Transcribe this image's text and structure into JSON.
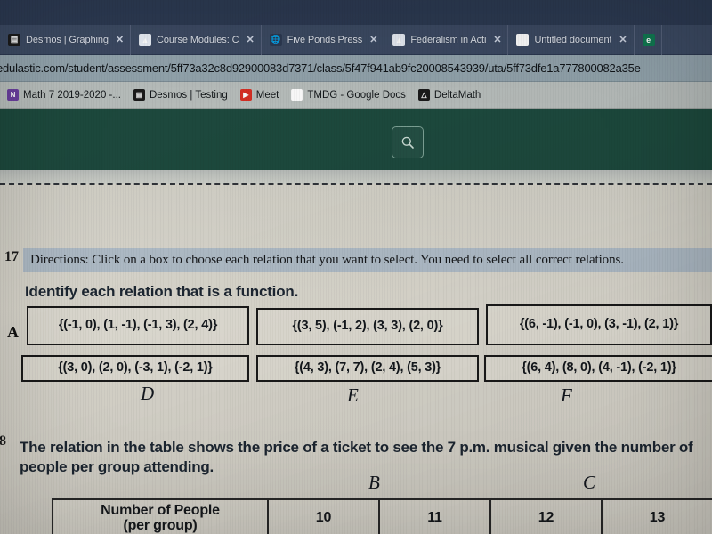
{
  "browser": {
    "tabs": [
      {
        "title": "Desmos | Graphing",
        "favicon": "desmos-icon",
        "close": "✕"
      },
      {
        "title": "Course Modules: C",
        "favicon": "canvas-icon",
        "close": "✕"
      },
      {
        "title": "Five Ponds Press",
        "favicon": "globe-icon",
        "close": "✕"
      },
      {
        "title": "Federalism in Acti",
        "favicon": "canvas-icon",
        "close": "✕"
      },
      {
        "title": "Untitled document",
        "favicon": "docs-icon",
        "close": "✕"
      }
    ],
    "url": "edulastic.com/student/assessment/5ff73a32c8d92900083d7371/class/5f47f941ab9fc20008543939/uta/5ff73dfe1a777800082a35e",
    "bookmarks": [
      {
        "label": "Math 7 2019-2020 -...",
        "icon": "onenote-icon"
      },
      {
        "label": "Desmos | Testing",
        "icon": "desmos-icon"
      },
      {
        "label": "Meet",
        "icon": "meet-icon"
      },
      {
        "label": "TMDG - Google Docs",
        "icon": "docs-icon"
      },
      {
        "label": "DeltaMath",
        "icon": "deltamath-icon"
      }
    ]
  },
  "app": {
    "header_color": "#1d4a3e",
    "search_icon": "search-icon"
  },
  "question17": {
    "number": "17",
    "directions": "Directions: Click on a box to choose each relation that you want to select. You need to select all correct relations.",
    "prompt": "Identify each relation that is a function.",
    "choices": [
      {
        "letter": "A",
        "text": "{(-1, 0), (1, -1), (-1, 3), (2, 4)}",
        "handwritten": ""
      },
      {
        "letter": "B",
        "text": "{(3, 5), (-1, 2), (3, 3), (2, 0)}",
        "handwritten": "B"
      },
      {
        "letter": "C",
        "text": "{(6, -1), (-1, 0), (3, -1), (2, 1)}",
        "handwritten": "C"
      },
      {
        "letter": "D",
        "text": "{(3, 0), (2, 0), (-3, 1), (-2, 1)}",
        "handwritten": "D"
      },
      {
        "letter": "E",
        "text": "{(4, 3), (7, 7), (2, 4), (5, 3)}",
        "handwritten": "E"
      },
      {
        "letter": "F",
        "text": "{(6, 4), (8, 0), (4, -1), (-2, 1)}",
        "handwritten": "F"
      }
    ]
  },
  "question18": {
    "number": "8",
    "text": "The relation in the table shows the price of a ticket to see the 7 p.m. musical given the number of people per group attending.",
    "table": {
      "row_header": "Number of People (per group)",
      "row_header_line1": "Number of People",
      "row_header_line2": "(per group)",
      "values": [
        "10",
        "11",
        "12",
        "13"
      ]
    }
  }
}
